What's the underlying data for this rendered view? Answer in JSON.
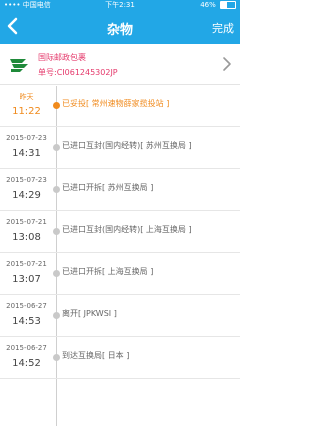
{
  "status_bar": {
    "carrier": "•••• 中国电信",
    "time": "下午2:31",
    "battery": "46%"
  },
  "nav": {
    "title": "杂物",
    "done_label": "完成"
  },
  "package": {
    "carrier_name": "国际邮政包裹",
    "tracking_label": "单号:CI061245302JP"
  },
  "events": [
    {
      "date": "昨天",
      "time": "11:22",
      "status": "已妥投[ 常州速物薛家揽投站 ]"
    },
    {
      "date": "2015-07-23",
      "time": "14:31",
      "status": "已进口互封(国内经转)[ 苏州互换局 ]"
    },
    {
      "date": "2015-07-23",
      "time": "14:29",
      "status": "已进口开拆[ 苏州互换局 ]"
    },
    {
      "date": "2015-07-21",
      "time": "13:08",
      "status": "已进口互封(国内经转)[ 上海互换局 ]"
    },
    {
      "date": "2015-07-21",
      "time": "13:07",
      "status": "已进口开拆[ 上海互换局 ]"
    },
    {
      "date": "2015-06-27",
      "time": "14:53",
      "status": "离开[ JPKWSI ]"
    },
    {
      "date": "2015-06-27",
      "time": "14:52",
      "status": "到达互换局[ 日本 ]"
    }
  ],
  "colors": {
    "header": "#22a7e6",
    "accent_latest": "#f08a1c",
    "tracking_text": "#e5396b"
  }
}
